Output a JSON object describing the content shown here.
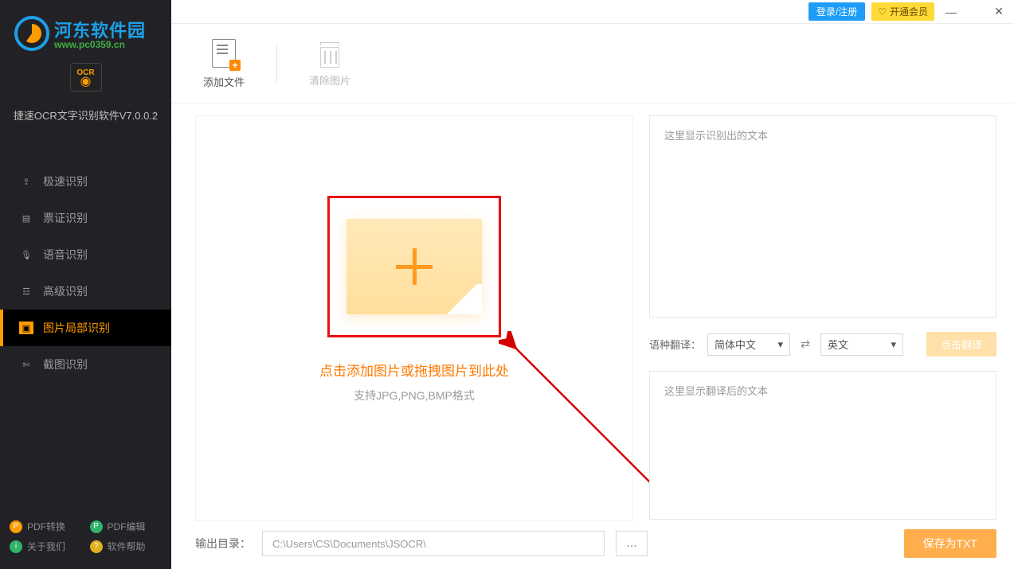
{
  "brand": {
    "name": "河东软件园",
    "url_text": "www.pc0359.cn",
    "ocr_badge": "OCR"
  },
  "app_title": "捷速OCR文字识别软件V7.0.0.2",
  "header": {
    "login": "登录/注册",
    "vip": "开通会员",
    "vip_icon": "♡"
  },
  "toolbar": {
    "add_file": "添加文件",
    "clear_images": "清除图片"
  },
  "nav": [
    {
      "icon": "⇪",
      "label": "极速识别"
    },
    {
      "icon": "▤",
      "label": "票证识别"
    },
    {
      "icon": "🎙",
      "label": "语音识别"
    },
    {
      "icon": "☲",
      "label": "高级识别"
    },
    {
      "icon": "▣",
      "label": "图片局部识别"
    },
    {
      "icon": "✄",
      "label": "截图识别"
    }
  ],
  "bottom_links": [
    {
      "color": "orange",
      "glyph": "P",
      "label": "PDF转换"
    },
    {
      "color": "green",
      "glyph": "P",
      "label": "PDF编辑"
    },
    {
      "color": "green",
      "glyph": "i",
      "label": "关于我们"
    },
    {
      "color": "yellow",
      "glyph": "?",
      "label": "软件帮助"
    }
  ],
  "drop": {
    "title": "点击添加图片或拖拽图片到此处",
    "subtitle": "支持JPG,PNG,BMP格式"
  },
  "right": {
    "recognized_ph": "这里显示识别出的文本",
    "translate_label": "语种翻译：",
    "lang_from": "简体中文",
    "lang_to": "英文",
    "translate_btn": "点击翻译",
    "translated_ph": "这里显示翻译后的文本"
  },
  "output": {
    "label": "输出目录：",
    "path": "C:\\Users\\CS\\Documents\\JSOCR\\",
    "browse": "...",
    "save": "保存为TXT"
  }
}
